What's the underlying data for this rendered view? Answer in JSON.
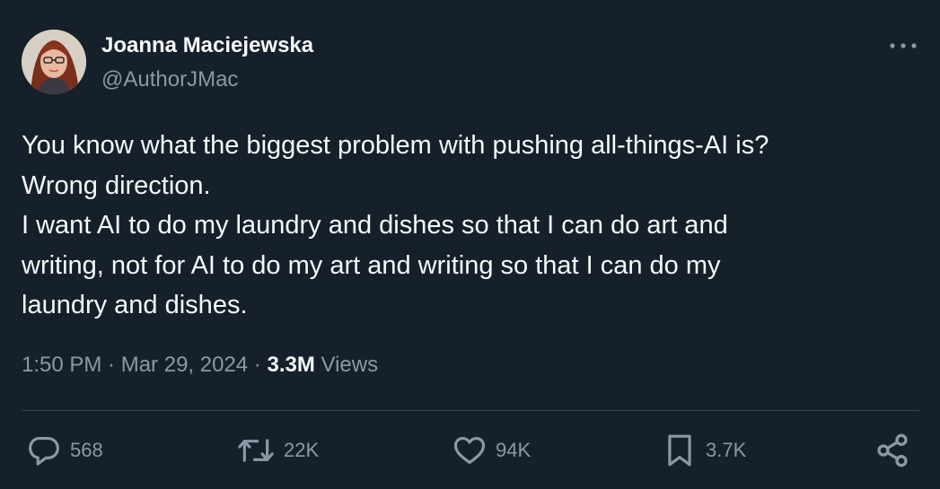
{
  "author": {
    "name": "Joanna Maciejewska",
    "handle": "@AuthorJMac"
  },
  "tweet": {
    "lines": [
      "You know what the biggest problem with pushing all-things-AI is?",
      "Wrong direction.",
      "I want AI to do my laundry and dishes so that I can do art and",
      "writing, not for AI to do my art and writing so that I can do my",
      "laundry and dishes."
    ],
    "time": "1:50 PM",
    "date": "Mar 29, 2024",
    "separator": " · ",
    "views_count": "3.3M",
    "views_label": "Views"
  },
  "actions": {
    "replies": "568",
    "reposts": "22K",
    "likes": "94K",
    "bookmarks": "3.7K"
  },
  "icons": {
    "avatar": "avatar",
    "more": "more-horizontal-icon",
    "reply": "reply-icon",
    "repost": "repost-icon",
    "like": "heart-icon",
    "bookmark": "bookmark-icon",
    "share": "share-icon"
  },
  "colors": {
    "background": "#15202b",
    "text": "#f7f9f9",
    "muted": "#8b98a5",
    "divider": "#38444d"
  }
}
